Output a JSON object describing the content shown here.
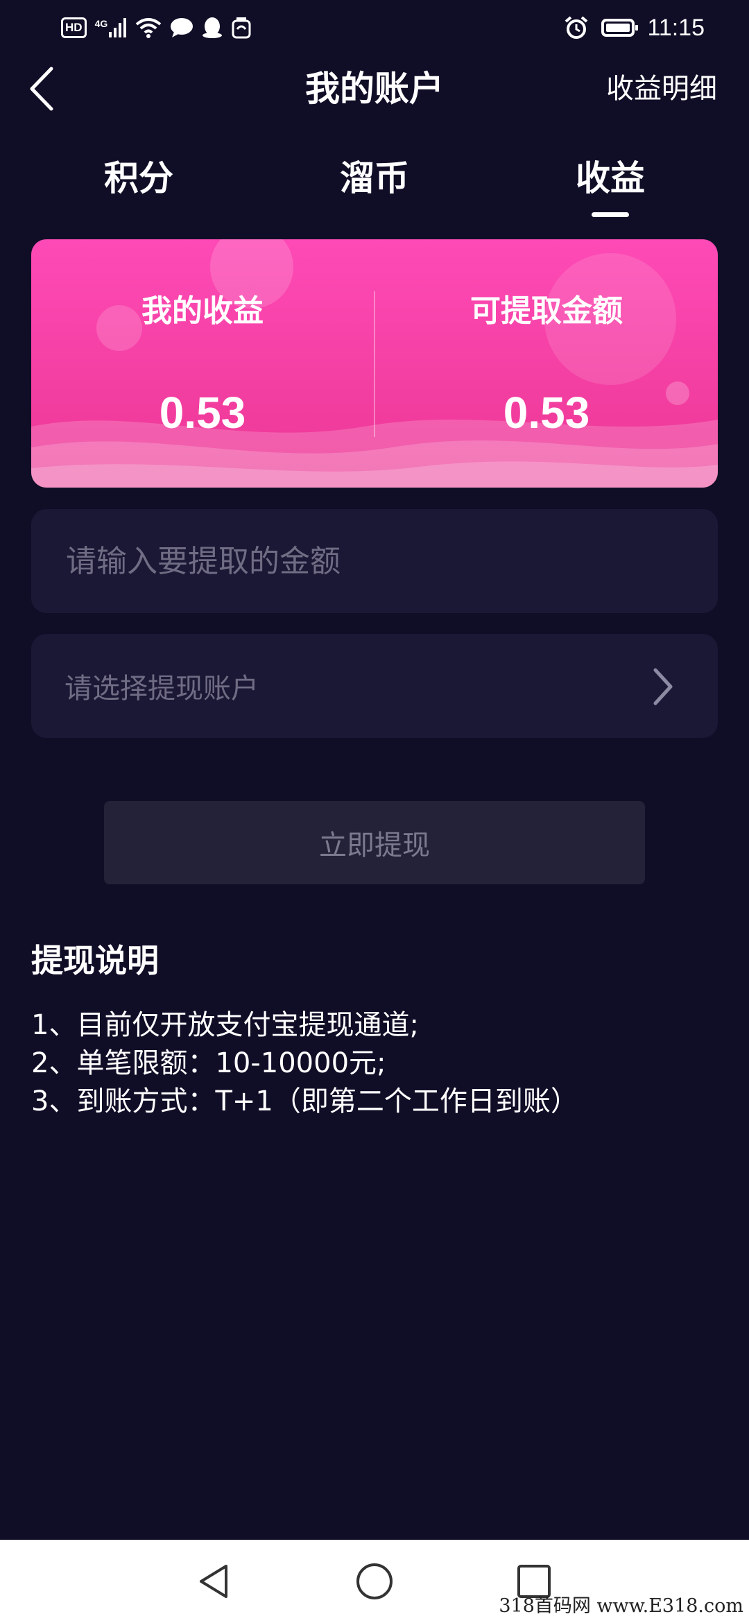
{
  "status_bar": {
    "hd_badge": "HD",
    "network": "4G",
    "time": "11:15"
  },
  "header": {
    "title": "我的账户",
    "detail_link": "收益明细"
  },
  "tabs": [
    {
      "label": "积分"
    },
    {
      "label": "溜币"
    },
    {
      "label": "收益",
      "active": true
    }
  ],
  "earnings_card": {
    "my_earnings_label": "我的收益",
    "my_earnings_value": "0.53",
    "withdrawable_label": "可提取金额",
    "withdrawable_value": "0.53",
    "gradient_top": "#fe4ab6",
    "gradient_bottom": "#ec3794"
  },
  "form": {
    "amount_placeholder": "请输入要提取的金额",
    "account_placeholder": "请选择提现账户",
    "withdraw_button": "立即提现"
  },
  "instructions": {
    "title": "提现说明",
    "lines": [
      "1、目前仅开放支付宝提现通道;",
      "2、单笔限额：10-10000元;",
      "3、到账方式：T+1（即第二个工作日到账）"
    ]
  },
  "watermark": "318首码网 www.E318.com",
  "colors": {
    "background": "#100e27",
    "field_background": "#1b1836",
    "button_background": "#242238",
    "placeholder": "#6f6c84"
  }
}
